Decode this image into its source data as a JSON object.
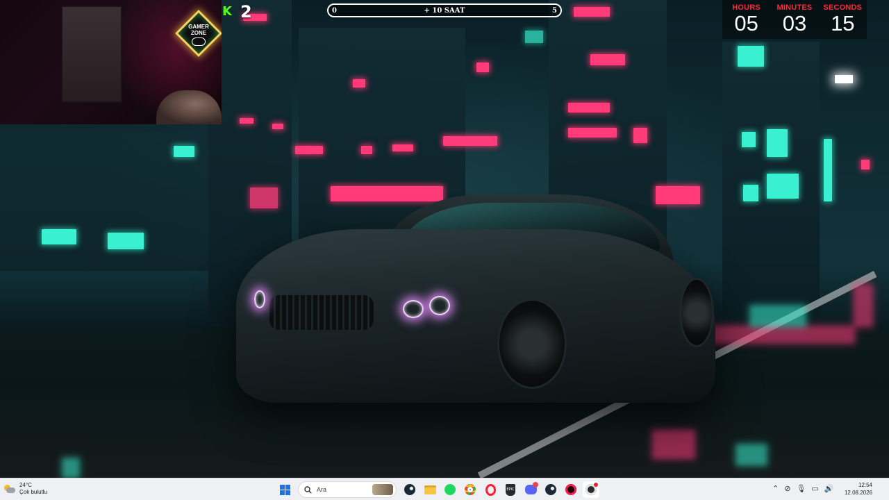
{
  "overlay": {
    "kick_count": "2",
    "subathon": {
      "left_value": "0",
      "center_label": "+ 10 SAAT",
      "right_value": "5",
      "progress": 0.0
    },
    "countdown": {
      "hours_label": "HOURS",
      "hours": "05",
      "minutes_label": "MINUTES",
      "minutes": "03",
      "seconds_label": "SECONDS",
      "seconds": "15"
    },
    "logo": {
      "line1": "GAMER",
      "line2": "ZONE"
    }
  },
  "taskbar": {
    "weather": {
      "temperature": "24°C",
      "condition": "Çok bulutlu"
    },
    "search_placeholder": "Ara",
    "apps": [
      "windows-start",
      "search",
      "steam",
      "file-explorer",
      "spotify",
      "chrome",
      "opera",
      "epic-games",
      "discord",
      "steam",
      "opera-gx",
      "obs"
    ],
    "clock": {
      "time": "12:54",
      "date": "12.08.2026"
    }
  },
  "colors": {
    "countdown_label": "#ff2a35",
    "kick_green": "#53fc18",
    "neon_pink": "#ff3b7a",
    "neon_cyan": "#39f0d0"
  }
}
